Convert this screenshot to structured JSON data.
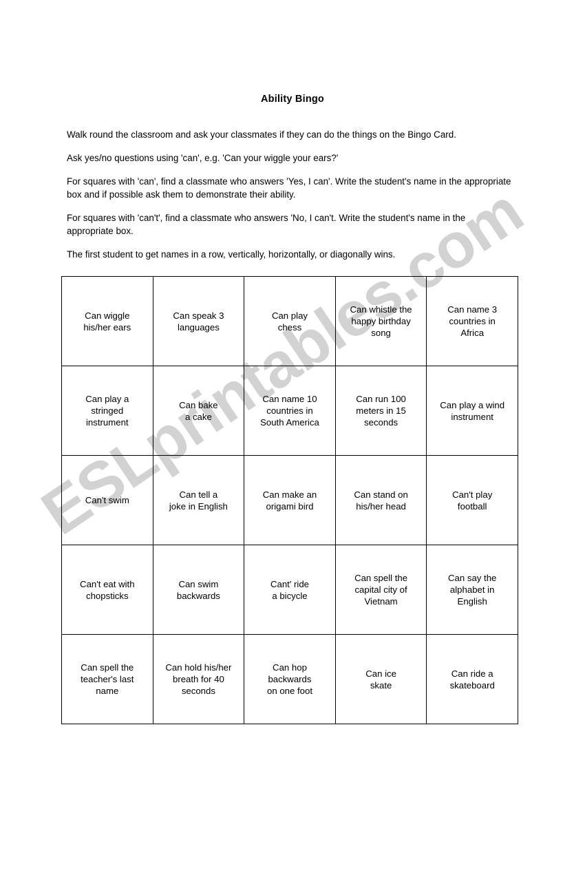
{
  "document": {
    "title": "Ability Bingo",
    "intro_paragraphs": [
      "Walk round the classroom and ask your classmates if they can do the things on the Bingo Card.",
      "Ask yes/no questions using 'can', e.g. 'Can your wiggle your ears?'",
      "For squares with 'can', find a classmate who answers 'Yes, I can'. Write the student's name in the appropriate box and if possible ask them to demonstrate their ability.",
      "For squares with 'can't', find a classmate who answers 'No, I can't. Write the student's name in the appropriate box.",
      "The first student to get names in a row, vertically, horizontally, or diagonally wins."
    ]
  },
  "watermark": {
    "text": "ESLprintables.com",
    "color": "#d2d2d2"
  },
  "bingo": {
    "rows": 5,
    "columns": 5,
    "cells": [
      [
        {
          "lines": [
            "Can wiggle",
            "his/her ears"
          ]
        },
        {
          "lines": [
            "Can speak 3",
            "languages"
          ]
        },
        {
          "lines": [
            "Can play",
            "chess"
          ]
        },
        {
          "lines": [
            "Can whistle the",
            "happy birthday",
            "song"
          ]
        },
        {
          "lines": [
            "Can name 3",
            "countries in",
            "Africa"
          ]
        }
      ],
      [
        {
          "lines": [
            "Can play a",
            "stringed",
            "instrument"
          ]
        },
        {
          "lines": [
            "Can bake",
            "a cake"
          ]
        },
        {
          "lines": [
            "Can name 10",
            "countries in",
            "South America"
          ]
        },
        {
          "lines": [
            "Can run 100",
            "meters in 15",
            "seconds"
          ]
        },
        {
          "lines": [
            "Can play a wind",
            "instrument"
          ]
        }
      ],
      [
        {
          "lines": [
            "Can't swim"
          ]
        },
        {
          "lines": [
            "Can tell a",
            "joke in English"
          ]
        },
        {
          "lines": [
            "Can make an",
            "origami bird"
          ]
        },
        {
          "lines": [
            "Can stand on",
            "his/her head"
          ]
        },
        {
          "lines": [
            "Can't play",
            "football"
          ]
        }
      ],
      [
        {
          "lines": [
            "Can't eat with",
            "chopsticks"
          ]
        },
        {
          "lines": [
            "Can swim",
            "backwards"
          ]
        },
        {
          "lines": [
            "Cant' ride",
            "a bicycle"
          ]
        },
        {
          "lines": [
            "Can spell the",
            "capital city of",
            "Vietnam"
          ]
        },
        {
          "lines": [
            "Can say the",
            "alphabet in",
            "English"
          ]
        }
      ],
      [
        {
          "lines": [
            "Can spell the",
            "teacher's last",
            "name"
          ]
        },
        {
          "lines": [
            "Can hold his/her",
            "breath for 40",
            "seconds"
          ]
        },
        {
          "lines": [
            "Can hop",
            "backwards",
            "on one foot"
          ]
        },
        {
          "lines": [
            "Can ice",
            "skate"
          ]
        },
        {
          "lines": [
            "Can ride a",
            "skateboard"
          ]
        }
      ]
    ]
  }
}
